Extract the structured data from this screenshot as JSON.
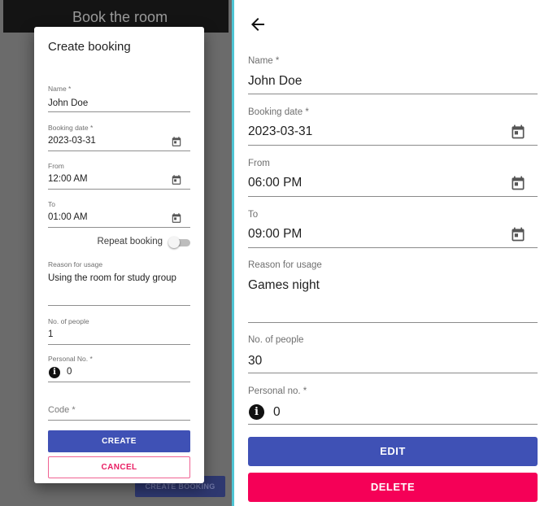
{
  "background_screen": {
    "app_title": "Book the room",
    "create_booking_button": "CREATE BOOKING"
  },
  "create_dialog": {
    "title": "Create booking",
    "name": {
      "label": "Name *",
      "value": "John Doe"
    },
    "booking_date": {
      "label": "Booking date *",
      "value": "2023-03-31",
      "icon": "calendar-icon"
    },
    "from": {
      "label": "From",
      "value": "12:00 AM",
      "icon": "calendar-icon"
    },
    "to": {
      "label": "To",
      "value": "01:00 AM",
      "icon": "calendar-icon"
    },
    "repeat_booking": {
      "label": "Repeat booking",
      "checked": false
    },
    "reason": {
      "label": "Reason for usage",
      "value": "Using the room for study group"
    },
    "people": {
      "label": "No. of people",
      "value": "1"
    },
    "personal_no": {
      "label": "Personal No. *",
      "value": "0",
      "icon": "info-icon"
    },
    "code": {
      "placeholder": "Code *"
    },
    "create_label": "CREATE",
    "cancel_label": "CANCEL"
  },
  "detail_view": {
    "back_icon": "arrow-left-icon",
    "name": {
      "label": "Name *",
      "value": "John Doe"
    },
    "booking_date": {
      "label": "Booking date *",
      "value": "2023-03-31",
      "icon": "calendar-icon"
    },
    "from": {
      "label": "From",
      "value": "06:00 PM",
      "icon": "calendar-icon"
    },
    "to": {
      "label": "To",
      "value": "09:00 PM",
      "icon": "calendar-icon"
    },
    "reason": {
      "label": "Reason for usage",
      "value": "Games night"
    },
    "people": {
      "label": "No. of people",
      "value": "30"
    },
    "personal_no": {
      "label": "Personal no. *",
      "value": "0",
      "icon": "info-icon"
    },
    "edit_label": "EDIT",
    "delete_label": "DELETE"
  },
  "colors": {
    "primary": "#3f51b5",
    "secondary": "#f50057",
    "cancel_text": "#e91e63",
    "divider": "#4fc4d4",
    "app_bar": "#141414",
    "overlay": "#6b6b6b"
  }
}
